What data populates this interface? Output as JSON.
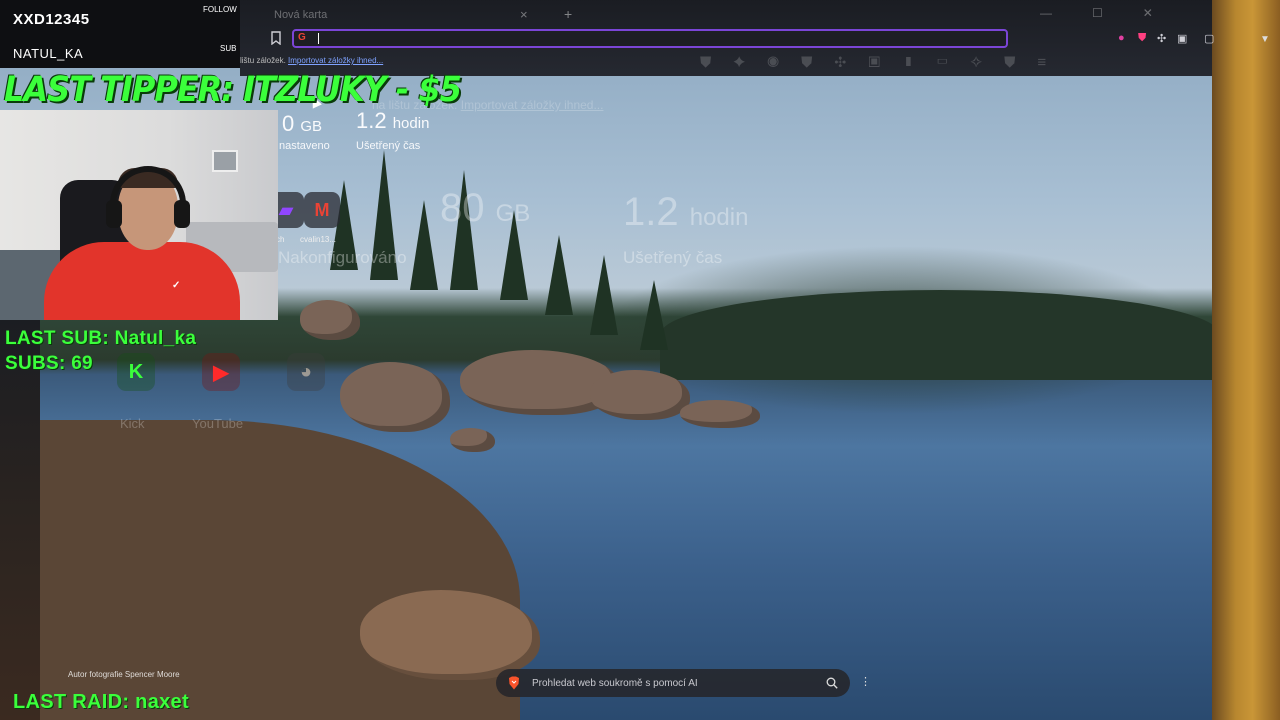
{
  "overlay": {
    "follow_name": "XXD12345",
    "follow_tag": "FOLLOW",
    "sub_name": "NATUL_KA",
    "sub_tag": "SUB",
    "last_tipper": "LAST TIPPER: ITZLUKY - $5",
    "last_sub": "LAST SUB: Natul_ka",
    "subs_count": "SUBS: 69",
    "last_raid": "LAST RAID: naxet",
    "accent_color": "#3bff3b"
  },
  "browser": {
    "tab_title": "Nová karta",
    "tab_close": "×",
    "tab_new": "+",
    "url_value": "",
    "search_engine_icon": "google-g-icon",
    "bookmarks_bar_text": "lištu záložek.",
    "bookmarks_bar_link": "Importovat záložky ihned...",
    "accent_color": "#7b45d6"
  },
  "newtab": {
    "stat_data_value": "0",
    "stat_data_unit": "GB",
    "stat_data_label": "nastaveno",
    "stat_time_value": "1.2",
    "stat_time_unit": "hodin",
    "stat_time_label": "Ušetřený čas",
    "ghost_bookmarks_text": "na lištu záložek.",
    "ghost_bookmarks_link": "Importovat záložky ihned...",
    "ghost_data_value": "80",
    "ghost_data_unit": "GB",
    "ghost_data_label": "Nakonfigurováno",
    "ghost_time_value": "1.2",
    "ghost_time_unit": "hodin",
    "ghost_time_label": "Ušetřený čas",
    "tiles": [
      {
        "label": "ch",
        "icon": "twitch-icon"
      },
      {
        "label": "cvalin13...",
        "icon": "gmail-icon"
      }
    ],
    "ghost_tiles": [
      {
        "label": "Kick",
        "icon": "kick-icon",
        "glyph": "K"
      },
      {
        "label": "YouTube",
        "icon": "youtube-icon",
        "glyph": "▶"
      }
    ],
    "photo_credit": "Autor fotografie Spencer Moore",
    "search_placeholder": "Prohledat web soukromě s pomocí AI"
  }
}
